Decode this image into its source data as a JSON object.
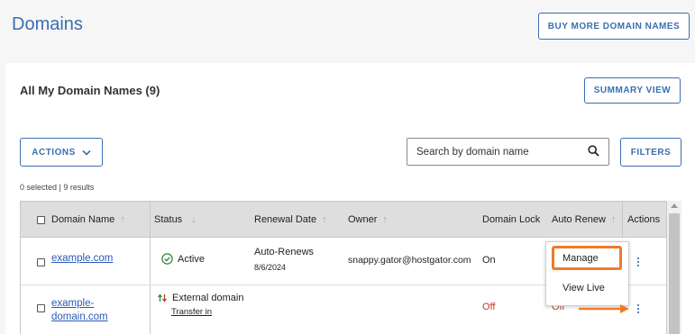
{
  "header": {
    "title": "Domains",
    "buy_more_label": "BUY MORE DOMAIN NAMES"
  },
  "card": {
    "title": "All My Domain Names (9)",
    "summary_view_label": "SUMMARY VIEW",
    "actions_label": "ACTIONS",
    "filters_label": "FILTERS",
    "search_placeholder": "Search by domain name",
    "results_text": "0 selected | 9 results"
  },
  "table": {
    "columns": {
      "domain_name": "Domain Name",
      "status": "Status",
      "renewal_date": "Renewal Date",
      "owner": "Owner",
      "domain_lock": "Domain Lock",
      "auto_renew": "Auto Renew",
      "actions": "Actions"
    },
    "rows": [
      {
        "domain": "example.com",
        "status": "Active",
        "renewal": "Auto-Renews",
        "renewal_date": "8/6/2024",
        "owner": "snappy.gator@hostgator.com",
        "domain_lock": "On",
        "auto_renew": ""
      },
      {
        "domain_line1": "example-",
        "domain_line2": "domain.com",
        "status": "External domain",
        "status_link": "Transfer in",
        "domain_lock": "Off",
        "auto_renew": "Off"
      }
    ]
  },
  "dropdown": {
    "items": [
      "Manage",
      "View Live"
    ]
  },
  "colors": {
    "accent": "#3a6fb0",
    "link": "#2a5bb8",
    "highlight": "#ef7b2b",
    "off": "#c0392b",
    "active": "#2e8b3c"
  }
}
